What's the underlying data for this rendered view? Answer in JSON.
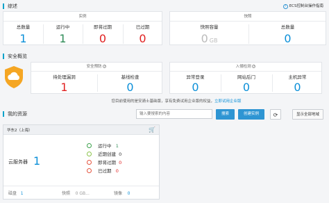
{
  "overview": {
    "title": "综述",
    "guide_link": "ECS控制台操作指南",
    "instances": {
      "header": "实例",
      "total_label": "总数量",
      "total_value": "1",
      "running_label": "运行中",
      "running_value": "1",
      "expiring_label": "即将过期",
      "expiring_value": "0",
      "expired_label": "已过期",
      "expired_value": "0"
    },
    "snapshots": {
      "header": "快照",
      "capacity_label": "快照容量",
      "capacity_value": "0",
      "capacity_unit": "GB",
      "total_label": "总数量",
      "total_value": "0"
    }
  },
  "security": {
    "title": "安全概览",
    "prevention": {
      "header": "安全预防",
      "vuln_label": "待处理漏洞",
      "vuln_value": "1",
      "baseline_label": "基线检查",
      "baseline_value": "0"
    },
    "intrusion": {
      "header": "入侵检测",
      "login_label": "异常登录",
      "login_value": "0",
      "backdoor_label": "网站后门",
      "backdoor_value": "0",
      "host_label": "主机异常",
      "host_value": "0"
    },
    "notice": "您目前使用的是安骑士基础版，享有免费试用企业版的权益，",
    "notice_link": "立即试用企业版"
  },
  "resources": {
    "title": "我的资源",
    "search_placeholder": "输入要搜索的内容",
    "search_button": "搜索",
    "create_button": "创建实例",
    "show_all_button": "显示全部地域",
    "region_card": {
      "region": "华东2（上海）",
      "server_label": "云服务器",
      "server_value": "1",
      "statuses": [
        {
          "label": "运行中",
          "value": "1",
          "color": "#3aa14a"
        },
        {
          "label": "近期创建",
          "value": "0",
          "color": "#8bc34a"
        },
        {
          "label": "即将过期",
          "value": "0",
          "color": "#e5533d"
        },
        {
          "label": "已过期",
          "value": "0",
          "color": "#e5533d"
        }
      ],
      "disk_label": "磁盘",
      "disk_value": "1",
      "snapshot_label": "快照",
      "snapshot_value": "0 GB...",
      "image_label": "镜像",
      "image_value": "0"
    }
  }
}
